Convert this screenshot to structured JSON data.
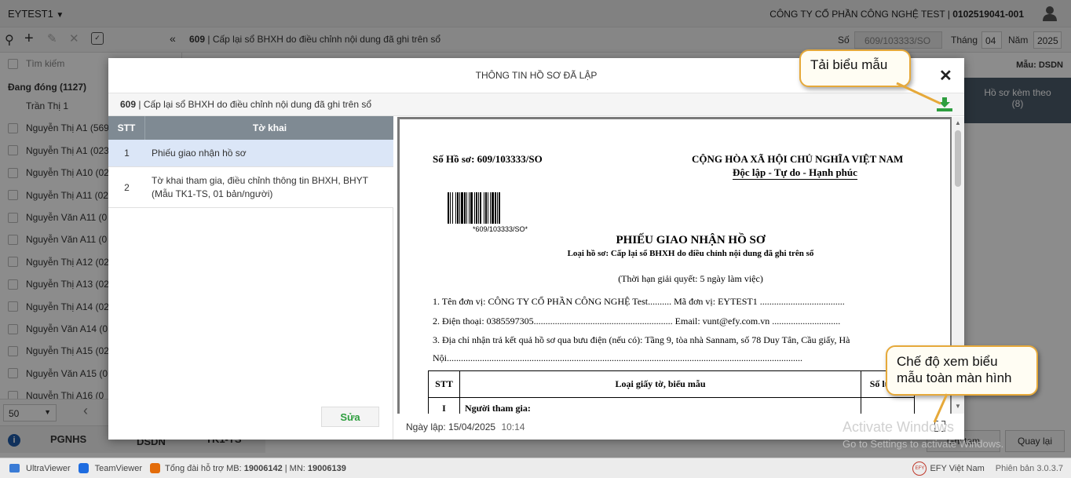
{
  "app": {
    "company_selector": "EYTEST1",
    "company_info": "CÔNG TY CỔ PHẦN CÔNG NGHỆ TEST | ",
    "company_tax": "0102519041-001"
  },
  "toolbar": {
    "collapse": "«",
    "doc_code": "609",
    "doc_title": "Cấp lại sổ BHXH do điều chỉnh nội dung đã ghi trên sổ",
    "so_label": "Số",
    "so_value": "609/103333/SO",
    "thang_label": "Tháng",
    "thang_value": "04",
    "nam_label": "Năm",
    "nam_value": "2025"
  },
  "sidebar": {
    "search_placeholder": "Tìm kiếm",
    "group": "Đang đóng (1127)",
    "items": [
      "Trần Thị 1",
      "Nguyễn Thị A1 (569",
      "Nguyễn Thị A1 (023",
      "Nguyễn Thị A10 (02",
      "Nguyễn Thị A11 (02",
      "Nguyễn Văn A11 (0",
      "Nguyễn Văn A11 (0",
      "Nguyễn Thị A12 (02",
      "Nguyễn Thị A13 (02",
      "Nguyễn Thị A14 (02",
      "Nguyễn Văn A14 (0",
      "Nguyễn Thị A15 (02",
      "Nguyễn Văn A15 (0",
      "Nguyễn Thị A16 (0"
    ],
    "page_size": "50"
  },
  "tabs": {
    "pgnhs": "PGNHS",
    "dsdn": "DSDN",
    "tk1ts": "TK1-TS"
  },
  "right_panel": {
    "mau_label": "Mẫu: DSDN",
    "attached": "Hồ sơ kèm theo",
    "attached_count": "(8)",
    "btn_save": "Ghi tạm",
    "btn_back": "Quay lại"
  },
  "modal": {
    "title": "THÔNG TIN HỒ SƠ ĐÃ LẬP",
    "doc_code": "609",
    "doc_title": "Cấp lại sổ BHXH do điều chỉnh nội dung đã ghi trên sổ",
    "col_stt": "STT",
    "col_tokhai": "Tờ khai",
    "rows": [
      {
        "stt": "1",
        "name": "Phiếu giao nhận hồ sơ"
      },
      {
        "stt": "2",
        "name": "Tờ khai tham gia, điều chỉnh thông tin BHXH, BHYT (Mẫu TK1-TS, 01 bản/người)"
      }
    ],
    "edit_button": "Sửa",
    "date_label": "Ngày lập:",
    "date_value": "15/04/2025",
    "time_value": "10:14"
  },
  "preview": {
    "so_ho_so": "Số Hồ sơ: 609/103333/SO",
    "quoc_hieu": "CỘNG HÒA XÃ HỘI CHỦ NGHĨA VIỆT NAM",
    "tieu_ngu": "Độc lập - Tự do - Hạnh phúc",
    "barcode_text": "*609/103333/SO*",
    "doc_heading": "PHIẾU GIAO NHẬN HỒ SƠ",
    "loai_ho_so": "Loại hồ sơ: Cấp lại sổ BHXH do điều chỉnh nội dung đã ghi trên sổ",
    "thoi_han": "(Thời hạn giải quyết: 5 ngày làm việc)",
    "line1": "1. Tên đơn vị: CÔNG TY CỔ PHẦN CÔNG NGHỆ Test.......... Mã đơn vị: EYTEST1 ....................................",
    "line2": "2. Điện thoại: 0385597305........................................................... Email: vunt@efy.com.vn .............................",
    "line3": "3. Địa chỉ nhận trả kết quả hồ sơ qua bưu điện (nếu có): Tầng 9, tòa nhà Sannam, số 78 Duy Tân, Cầu giấy, Hà",
    "line3b": "Nội.......................................................................................................................................................",
    "table_stt": "STT",
    "table_loai": "Loại giấy tờ, biểu mẫu",
    "table_soluong": "Số lượng",
    "row_i": "I",
    "row_i_label": "Người tham gia:"
  },
  "callouts": {
    "download": "Tải biểu mẫu",
    "fullscreen": "Chế độ xem biểu mẫu toàn màn hình"
  },
  "watermark": {
    "line1": "Activate Windows",
    "line2": "Go to Settings to activate Windows."
  },
  "statusbar": {
    "ultraviewer": "UltraViewer",
    "teamviewer": "TeamViewer",
    "hotline_prefix": "Tổng đài hỗ trợ MB: ",
    "hotline_mb": "19006142",
    "hotline_sep": " | MN: ",
    "hotline_mn": "19006139",
    "brand": "EFY Việt Nam",
    "version": "Phiên bản 3.0.3.7"
  },
  "colors": {
    "accent_green": "#2e9e3f",
    "header_gray": "#7f8a93",
    "callout_border": "#e6a93a",
    "selected_row": "#dbe6f7"
  }
}
